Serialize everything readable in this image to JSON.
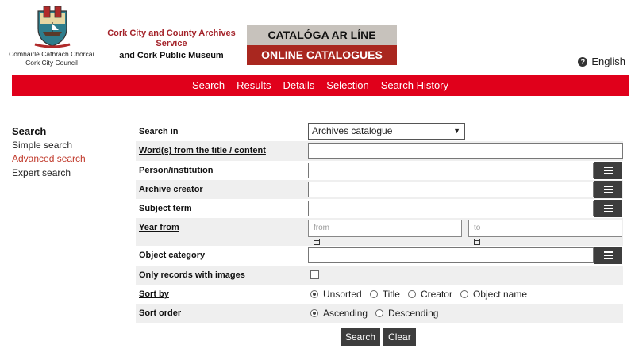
{
  "header": {
    "council_ga": "Comhairle Cathrach Chorcaí",
    "council_en": "Cork City Council",
    "archives_title": "Cork City and County Archives Service",
    "museum": "and Cork Public Museum",
    "catalogues_ga": "CATALÓGA AR LÍNE",
    "catalogues_en": "ONLINE CATALOGUES",
    "language": "English"
  },
  "nav": [
    "Search",
    "Results",
    "Details",
    "Selection",
    "Search History"
  ],
  "sidebar": {
    "heading": "Search",
    "items": [
      "Simple search",
      "Advanced search",
      "Expert search"
    ]
  },
  "form": {
    "search_in_label": "Search in",
    "search_in_value": "Archives catalogue",
    "words_label": "Word(s) from the title / content",
    "person_label": "Person/institution",
    "creator_label": "Archive creator",
    "subject_label": "Subject term",
    "year_label": "Year from",
    "year_from_placeholder": "from",
    "year_to_placeholder": "to",
    "object_label": "Object category",
    "images_label": "Only records with images",
    "sortby_label": "Sort by",
    "sortby_options": [
      "Unsorted",
      "Title",
      "Creator",
      "Object name"
    ],
    "sortorder_label": "Sort order",
    "sortorder_options": [
      "Ascending",
      "Descending"
    ]
  },
  "buttons": {
    "search": "Search",
    "clear": "Clear"
  },
  "colors": {
    "nav_red": "#e0001b",
    "catalogue_red": "#a9271f",
    "catalogue_grey": "#c7c2bc",
    "button_dark": "#3d3d3d"
  }
}
